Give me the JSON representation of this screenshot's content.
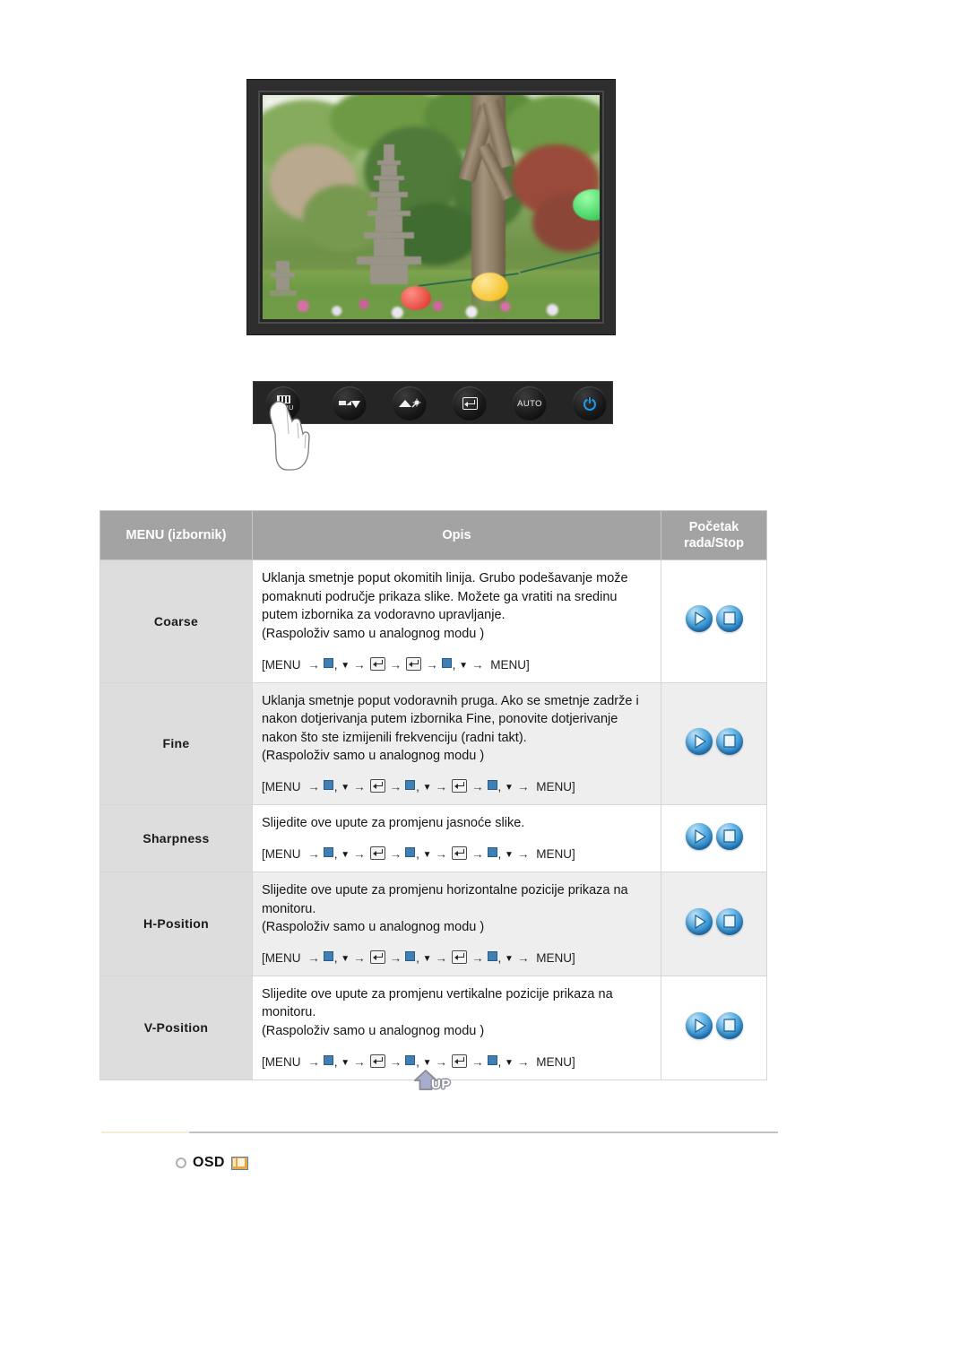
{
  "product_image": {
    "alt": "LCD monitor displaying a garden photograph with stone pagoda and lanterns",
    "bezel_color": "#2e2e2e"
  },
  "button_bar": {
    "buttons": [
      {
        "name": "menu-button",
        "label": "MENU",
        "icon": "menu-icon"
      },
      {
        "name": "down-adjust-button",
        "label": "",
        "icon": "minus-down-icon"
      },
      {
        "name": "up-brightness-button",
        "label": "",
        "icon": "plus-brightness-icon"
      },
      {
        "name": "enter-button",
        "label": "",
        "icon": "enter-icon"
      },
      {
        "name": "auto-button",
        "label": "AUTO",
        "icon": "auto-icon"
      },
      {
        "name": "power-button",
        "label": "",
        "icon": "power-icon"
      }
    ],
    "accent_power_color": "#1a9bea"
  },
  "table": {
    "headers": {
      "menu": "MENU (izbornik)",
      "description": "Opis",
      "control_line1": "Početak",
      "control_line2": "rada/Stop"
    },
    "header_bg": "#a3a3a3",
    "rows": [
      {
        "menu": "Coarse",
        "description": "Uklanja smetnje poput okomitih linija. Grubo podešavanje može pomaknuti područje prikaza slike. Možete ga vratiti na sredinu putem izbornika za vodoravno upravljanje.\n(Raspoloživ samo u analognog modu )",
        "path_prefix": "[MENU",
        "path_suffix": "MENU]",
        "path_steps": [
          "sq-dn",
          "enter",
          "enter",
          "sq-dn"
        ],
        "controls": [
          "play-ball-icon",
          "stop-ball-icon"
        ]
      },
      {
        "menu": "Fine",
        "description": "Uklanja smetnje poput vodoravnih pruga. Ako se smetnje zadrže i nakon dotjerivanja putem izbornika Fine, ponovite dotjerivanje nakon što ste izmijenili frekvenciju (radni takt).\n(Raspoloživ samo u analognog modu )",
        "path_prefix": "[MENU",
        "path_suffix": "MENU]",
        "path_steps": [
          "sq-dn",
          "enter",
          "sq-dn",
          "enter",
          "sq-dn"
        ],
        "controls": [
          "play-ball-icon",
          "stop-ball-icon"
        ]
      },
      {
        "menu": "Sharpness",
        "description": "Slijedite ove upute za promjenu jasnoće slike.",
        "path_prefix": "[MENU",
        "path_suffix": "MENU]",
        "path_steps": [
          "sq-dn",
          "enter",
          "sq-dn",
          "enter",
          "sq-dn"
        ],
        "controls": [
          "play-ball-icon",
          "stop-ball-icon"
        ]
      },
      {
        "menu": "H-Position",
        "description": "Slijedite ove upute za promjenu horizontalne pozicije prikaza na monitoru.\n(Raspoloživ samo u analognog modu )",
        "path_prefix": "[MENU",
        "path_suffix": "MENU]",
        "path_steps": [
          "sq-dn",
          "enter",
          "sq-dn",
          "enter",
          "sq-dn"
        ],
        "controls": [
          "play-ball-icon",
          "stop-ball-icon"
        ]
      },
      {
        "menu": "V-Position",
        "description": "Slijedite ove upute za promjenu vertikalne pozicije prikaza na monitoru.\n(Raspoloživ samo u analognog modu )",
        "path_prefix": "[MENU",
        "path_suffix": "MENU]",
        "path_steps": [
          "sq-dn",
          "enter",
          "sq-dn",
          "enter",
          "sq-dn"
        ],
        "controls": [
          "play-ball-icon",
          "stop-ball-icon"
        ]
      }
    ]
  },
  "up_button": {
    "label": "UP",
    "icon": "up-arrow-icon"
  },
  "osd_section": {
    "title": "OSD",
    "bullet_icon": "circle-bullet-icon",
    "icon": "osd-thumbnail-icon",
    "icon_color": "#f0a538"
  }
}
